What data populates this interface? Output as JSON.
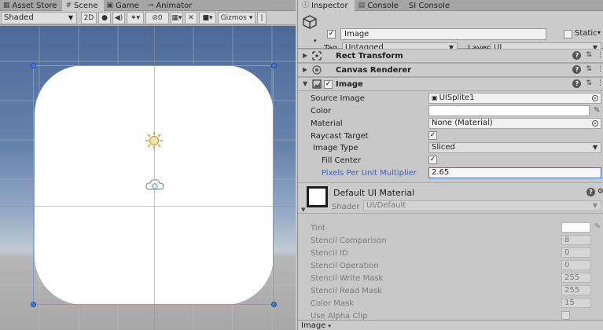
{
  "scene_panel": {
    "tabs": [
      {
        "label": "Asset Store",
        "icon": "asset-store-icon"
      },
      {
        "label": "Scene",
        "icon": "grid-icon"
      },
      {
        "label": "Game",
        "icon": "game-icon"
      },
      {
        "label": "Animator",
        "icon": "animator-icon"
      }
    ],
    "toolbar": {
      "shading_mode": "Shaded",
      "mode_2d": "2D",
      "hidden_count": "0",
      "gizmos": "Gizmos"
    }
  },
  "inspector": {
    "tabs": [
      {
        "label": "Inspector",
        "icon": "info-icon"
      },
      {
        "label": "Console",
        "icon": "console-icon"
      },
      {
        "label": "SI Console",
        "icon": ""
      }
    ],
    "gameobject": {
      "name": "Image",
      "static_label": "Static",
      "tag_label": "Tag",
      "tag_value": "Untagged",
      "layer_label": "Layer",
      "layer_value": "UI"
    },
    "components": {
      "rect_transform": "Rect Transform",
      "canvas_renderer": "Canvas Renderer",
      "image": "Image"
    },
    "image_props": {
      "source_image_label": "Source Image",
      "source_image_value": "UISplite1",
      "color_label": "Color",
      "material_label": "Material",
      "material_value": "None (Material)",
      "raycast_label": "Raycast Target",
      "image_type_label": "Image Type",
      "image_type_value": "Sliced",
      "fill_center_label": "Fill Center",
      "ppu_label": "Pixels Per Unit Multiplier",
      "ppu_value": "2.65"
    },
    "material": {
      "name": "Default UI Material",
      "shader_label": "Shader",
      "shader_value": "UI/Default",
      "props": [
        {
          "label": "Tint",
          "value": ""
        },
        {
          "label": "Stencil Comparison",
          "value": "8"
        },
        {
          "label": "Stencil ID",
          "value": "0"
        },
        {
          "label": "Stencil Operation",
          "value": "0"
        },
        {
          "label": "Stencil Write Mask",
          "value": "255"
        },
        {
          "label": "Stencil Read Mask",
          "value": "255"
        },
        {
          "label": "Color Mask",
          "value": "15"
        },
        {
          "label": "Use Alpha Clip",
          "value": ""
        }
      ]
    },
    "footer_label": "Image"
  },
  "colors": {
    "selection": "#3f7cda",
    "ppu_label": "#3a62b8"
  }
}
